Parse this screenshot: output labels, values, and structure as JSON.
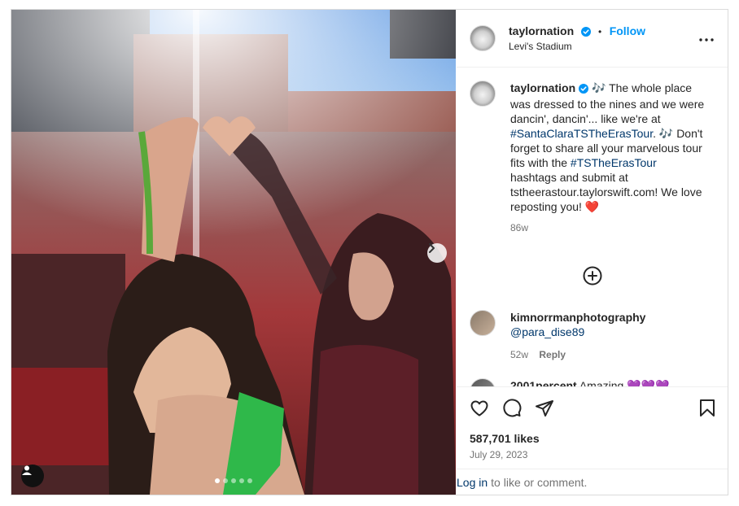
{
  "post": {
    "account": "taylornation",
    "location": "Levi's Stadium",
    "follow_label": "Follow",
    "separator": "•",
    "caption": {
      "text_part1": "🎶 The whole place was dressed to the nines and we were dancin', dancin'... like we're at ",
      "hashtag1": "#SantaClaraTSTheErasTour",
      "text_part2": ". 🎶 Don't forget to share all your marvelous tour fits with the ",
      "hashtag2": "#TSTheErasTour",
      "text_part3": " hashtags and submit at tstheerastour.taylorswift.com! We love reposting you! ❤️",
      "age": "86w"
    },
    "comments": [
      {
        "user": "kimnorrmanphotography",
        "text": "@para_dise89",
        "age": "52w",
        "reply_label": "Reply"
      },
      {
        "user": "2001percent",
        "text": "Amazing 💜💜💜"
      }
    ],
    "likes": "587,701 likes",
    "date": "July 29, 2023",
    "login_link": "Log in",
    "login_text": "to like or comment.",
    "carousel": {
      "count": 5,
      "active_index": 0
    }
  },
  "icons": {
    "more": "more-horizontal-icon",
    "verified": "verified-badge-icon",
    "load_more": "plus-circle-icon",
    "like": "heart-icon",
    "comment": "comment-icon",
    "share": "paper-plane-icon",
    "save": "bookmark-icon",
    "next": "chevron-right-icon",
    "tags": "user-tag-icon"
  },
  "colors": {
    "link_blue": "#0095f6",
    "hashtag": "#00376b",
    "verified": "#0095f6",
    "heart_red": "#ed4956",
    "purple_heart": "#a259e6"
  }
}
